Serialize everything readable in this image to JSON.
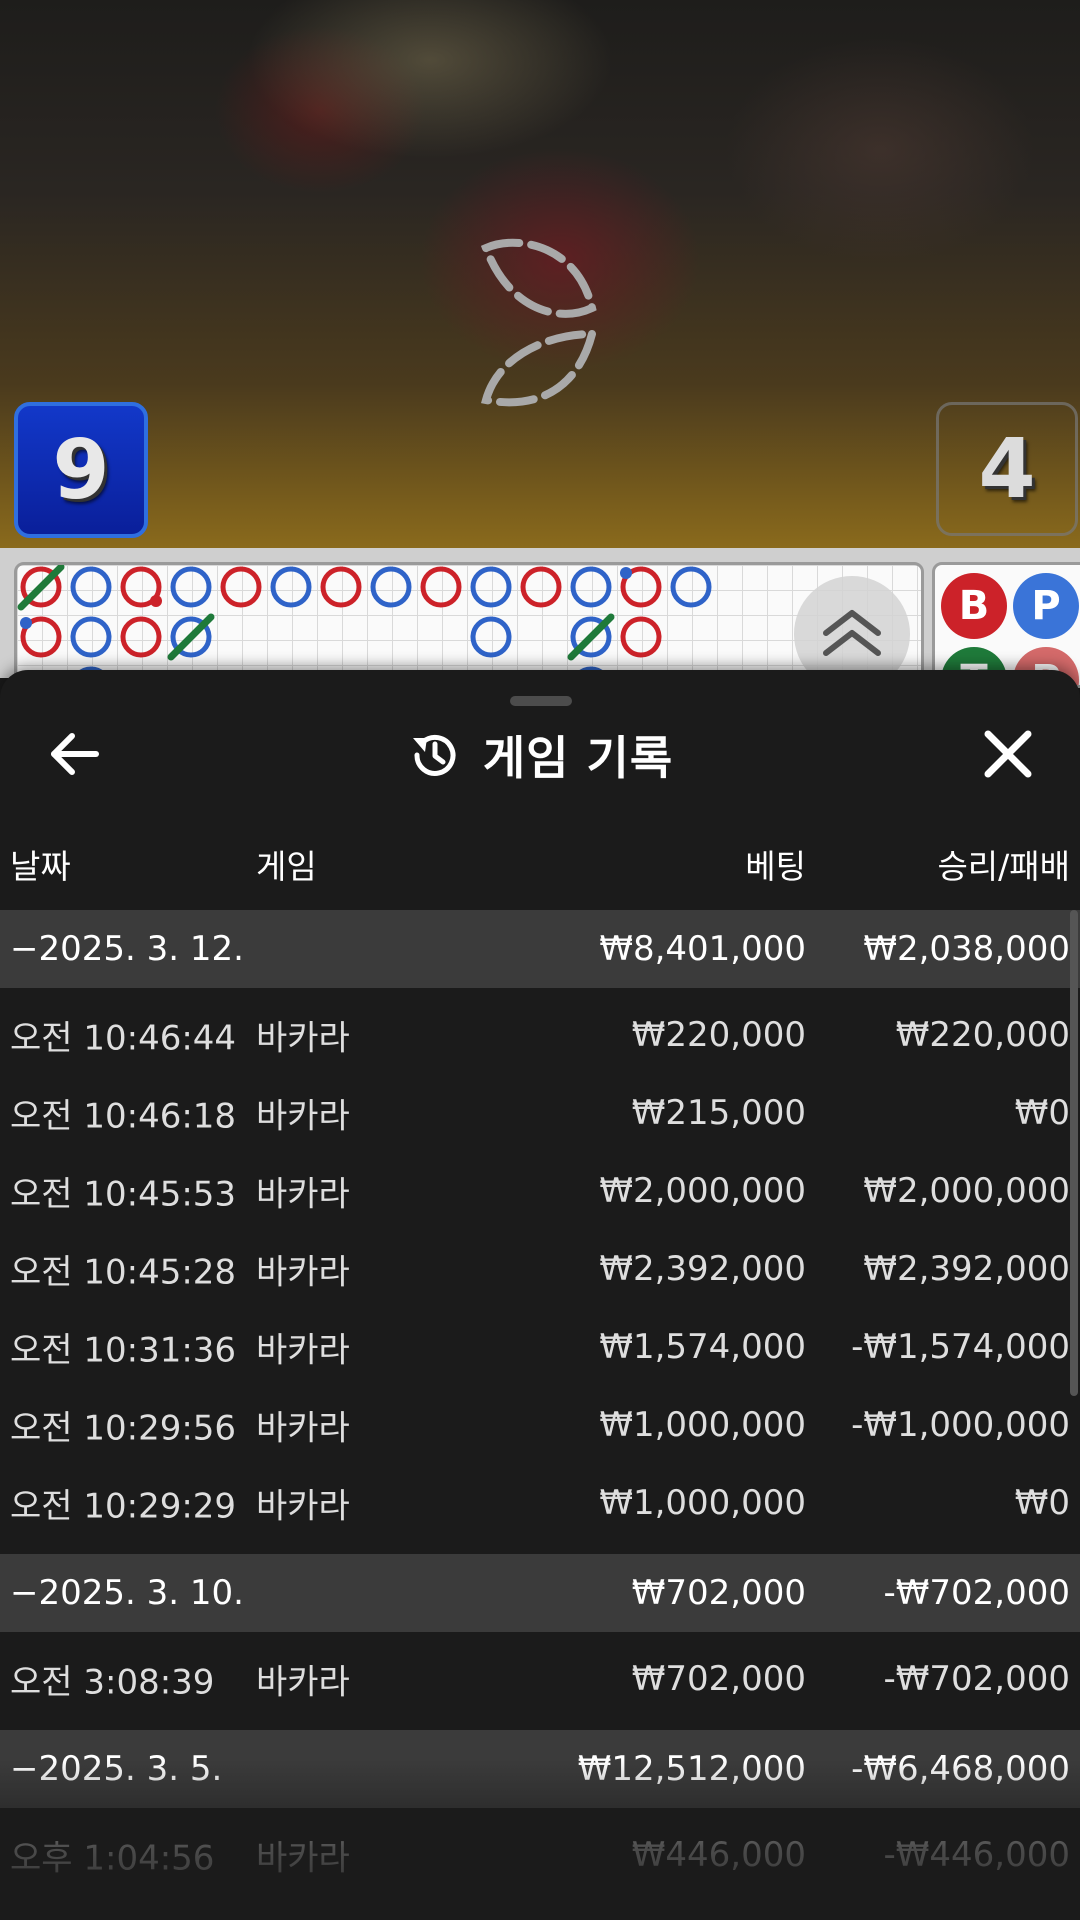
{
  "scores": {
    "player": "9",
    "banker": "4"
  },
  "colors": {
    "player": "#2f63c8",
    "banker": "#cc2229",
    "tie": "#1f7a3a"
  },
  "roadmap": {
    "cells": [
      {
        "col": 0,
        "row": 0,
        "c": "banker",
        "tie": true,
        "dotL": false,
        "dotR": false
      },
      {
        "col": 1,
        "row": 0,
        "c": "player",
        "tie": false,
        "dotL": false,
        "dotR": false
      },
      {
        "col": 2,
        "row": 0,
        "c": "banker",
        "tie": false,
        "dotL": false,
        "dotR": true
      },
      {
        "col": 3,
        "row": 0,
        "c": "player",
        "tie": false,
        "dotL": false,
        "dotR": false
      },
      {
        "col": 4,
        "row": 0,
        "c": "banker",
        "tie": false,
        "dotL": false,
        "dotR": false
      },
      {
        "col": 5,
        "row": 0,
        "c": "player",
        "tie": false,
        "dotL": false,
        "dotR": false
      },
      {
        "col": 6,
        "row": 0,
        "c": "banker",
        "tie": false,
        "dotL": false,
        "dotR": false
      },
      {
        "col": 7,
        "row": 0,
        "c": "player",
        "tie": false,
        "dotL": false,
        "dotR": false
      },
      {
        "col": 8,
        "row": 0,
        "c": "banker",
        "tie": false,
        "dotL": false,
        "dotR": false
      },
      {
        "col": 9,
        "row": 0,
        "c": "player",
        "tie": false,
        "dotL": false,
        "dotR": false
      },
      {
        "col": 10,
        "row": 0,
        "c": "banker",
        "tie": false,
        "dotL": false,
        "dotR": false
      },
      {
        "col": 11,
        "row": 0,
        "c": "player",
        "tie": false,
        "dotL": false,
        "dotR": false
      },
      {
        "col": 12,
        "row": 0,
        "c": "banker",
        "tie": false,
        "dotL": true,
        "dotR": false
      },
      {
        "col": 13,
        "row": 0,
        "c": "player",
        "tie": false,
        "dotL": false,
        "dotR": false
      },
      {
        "col": 0,
        "row": 1,
        "c": "banker",
        "tie": false,
        "dotL": true,
        "dotR": false
      },
      {
        "col": 1,
        "row": 1,
        "c": "player",
        "tie": false,
        "dotL": false,
        "dotR": false
      },
      {
        "col": 2,
        "row": 1,
        "c": "banker",
        "tie": false,
        "dotL": false,
        "dotR": false
      },
      {
        "col": 3,
        "row": 1,
        "c": "player",
        "tie": true,
        "dotL": false,
        "dotR": false
      },
      {
        "col": 9,
        "row": 1,
        "c": "player",
        "tie": false,
        "dotL": false,
        "dotR": false
      },
      {
        "col": 11,
        "row": 1,
        "c": "player",
        "tie": true,
        "dotL": false,
        "dotR": false
      },
      {
        "col": 12,
        "row": 1,
        "c": "banker",
        "tie": false,
        "dotL": false,
        "dotR": false
      },
      {
        "col": 1,
        "row": 2,
        "c": "player",
        "tie": false,
        "dotL": false,
        "dotR": false
      },
      {
        "col": 11,
        "row": 2,
        "c": "player",
        "tie": false,
        "dotL": false,
        "dotR": false
      }
    ]
  },
  "predictions": [
    {
      "label": "B",
      "color": "#cc2229"
    },
    {
      "label": "P",
      "color": "#3a74d8"
    },
    {
      "label": "T",
      "color": "#1f7a3a"
    },
    {
      "label": "P",
      "color": "#d46a6a"
    }
  ],
  "sheet": {
    "title": "게임 기록"
  },
  "columns": {
    "date": "날짜",
    "game": "게임",
    "bet": "베팅",
    "result": "승리/패배"
  },
  "rows": [
    {
      "type": "group",
      "date": "−2025. 3. 12.",
      "game": "",
      "bet": "₩8,401,000",
      "result": "₩2,038,000"
    },
    {
      "type": "item",
      "date": "오전 10:46:44",
      "game": "바카라",
      "bet": "₩220,000",
      "result": "₩220,000"
    },
    {
      "type": "item",
      "date": "오전 10:46:18",
      "game": "바카라",
      "bet": "₩215,000",
      "result": "₩0"
    },
    {
      "type": "item",
      "date": "오전 10:45:53",
      "game": "바카라",
      "bet": "₩2,000,000",
      "result": "₩2,000,000"
    },
    {
      "type": "item",
      "date": "오전 10:45:28",
      "game": "바카라",
      "bet": "₩2,392,000",
      "result": "₩2,392,000"
    },
    {
      "type": "item",
      "date": "오전 10:31:36",
      "game": "바카라",
      "bet": "₩1,574,000",
      "result": "-₩1,574,000"
    },
    {
      "type": "item",
      "date": "오전 10:29:56",
      "game": "바카라",
      "bet": "₩1,000,000",
      "result": "-₩1,000,000"
    },
    {
      "type": "item",
      "date": "오전 10:29:29",
      "game": "바카라",
      "bet": "₩1,000,000",
      "result": "₩0"
    },
    {
      "type": "group",
      "date": "−2025. 3. 10.",
      "game": "",
      "bet": "₩702,000",
      "result": "-₩702,000"
    },
    {
      "type": "item",
      "date": "오전 3:08:39",
      "game": "바카라",
      "bet": "₩702,000",
      "result": "-₩702,000"
    },
    {
      "type": "group",
      "date": "−2025. 3. 5.",
      "game": "",
      "bet": "₩12,512,000",
      "result": "-₩6,468,000"
    },
    {
      "type": "item",
      "date": "오후 1:04:56",
      "game": "바카라",
      "bet": "₩446,000",
      "result": "-₩446,000"
    }
  ]
}
